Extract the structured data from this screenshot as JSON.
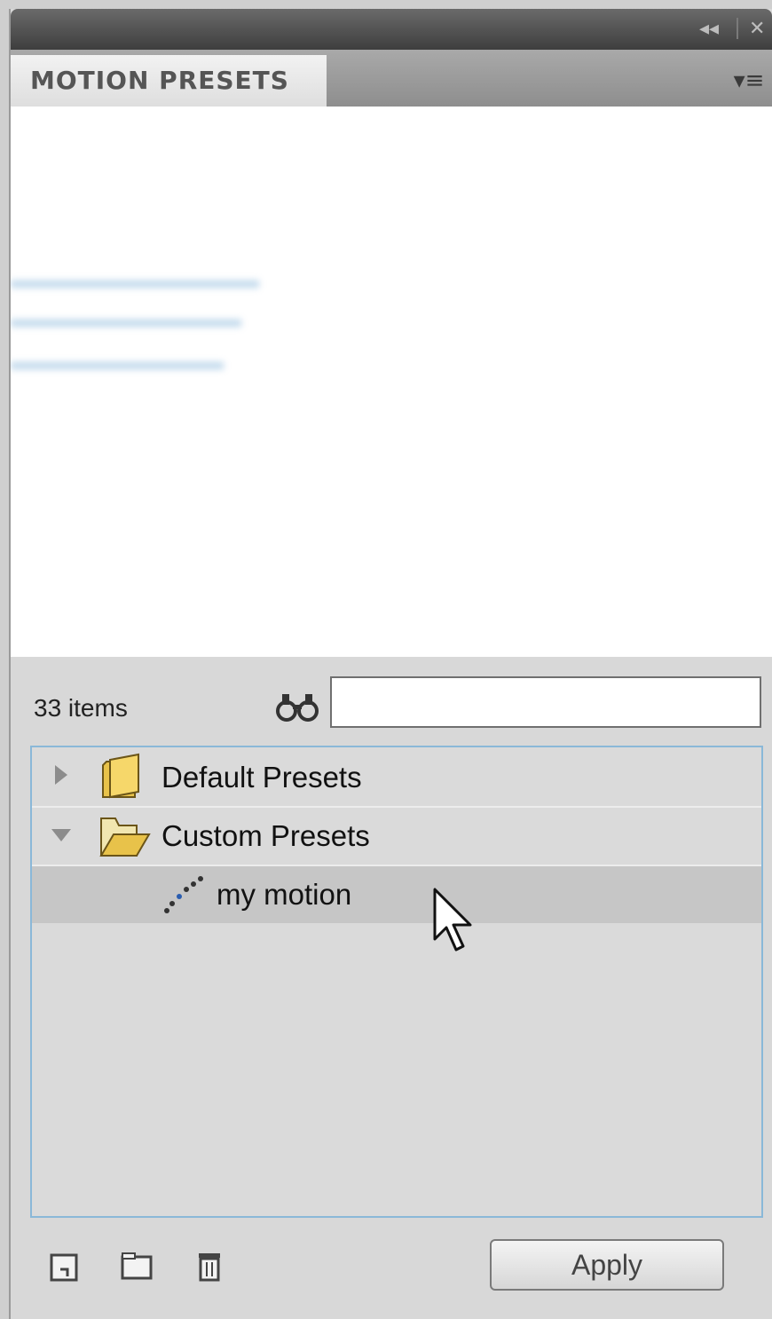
{
  "titlebar": {
    "collapse_icon": "double-left-arrow-icon",
    "collapse_glyph": "◂◂",
    "close_icon": "close-icon",
    "close_glyph": "✕"
  },
  "panel": {
    "tab_label": "MOTION PRESETS",
    "menu_icon": "panel-menu-icon",
    "menu_glyph": "▾≡"
  },
  "toolbar": {
    "item_count": "33 items",
    "search_icon": "binoculars-icon",
    "search_value": ""
  },
  "tree": {
    "items": [
      {
        "label": "Default Presets",
        "type": "folder",
        "expanded": false
      },
      {
        "label": "Custom Presets",
        "type": "folder",
        "expanded": true
      },
      {
        "label": "my motion",
        "type": "preset",
        "selected": true
      }
    ]
  },
  "footer": {
    "new_preset_icon": "new-preset-icon",
    "new_folder_icon": "new-folder-icon",
    "delete_icon": "trash-icon",
    "apply_label": "Apply"
  },
  "colors": {
    "tree_border": "#8ab8d8",
    "selection": "#c6c6c6",
    "folder": "#e8c24a"
  }
}
